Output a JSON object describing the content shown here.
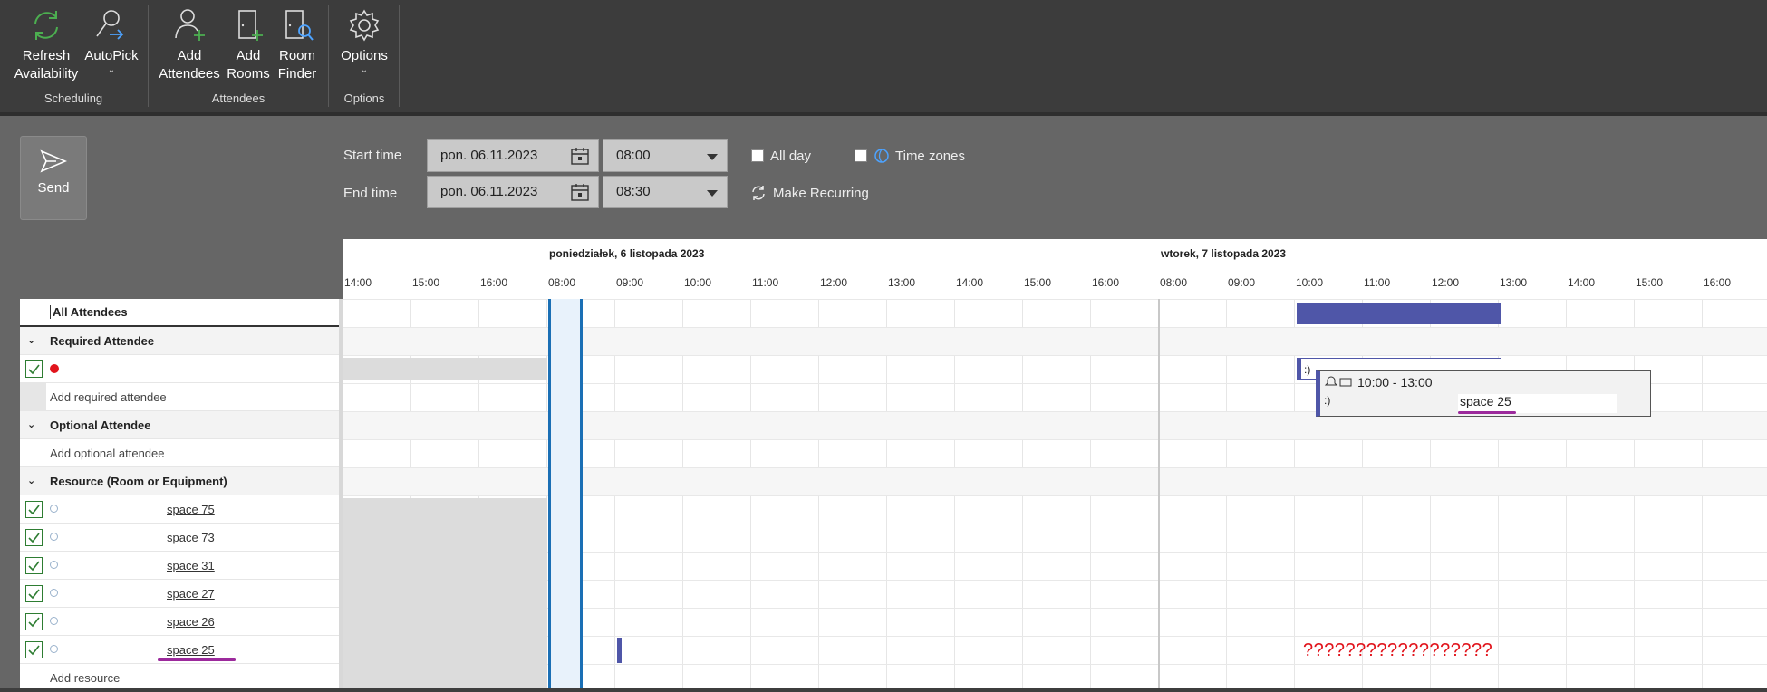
{
  "ribbon": {
    "buttons": [
      {
        "label1": "Refresh",
        "label2": "Availability"
      },
      {
        "label1": "AutoPick",
        "label2": "⌄"
      },
      {
        "label1": "Add",
        "label2": "Attendees"
      },
      {
        "label1": "Add",
        "label2": "Rooms"
      },
      {
        "label1": "Room",
        "label2": "Finder"
      },
      {
        "label1": "Options",
        "label2": "⌄"
      }
    ],
    "groups": [
      "Scheduling",
      "Attendees",
      "Options"
    ]
  },
  "send": {
    "label": "Send"
  },
  "time": {
    "start_label": "Start time",
    "end_label": "End time",
    "start_date": "pon. 06.11.2023",
    "start_time": "08:00",
    "end_date": "pon. 06.11.2023",
    "end_time": "08:30",
    "all_day": "All day",
    "time_zones": "Time zones",
    "make_recurring": "Make Recurring"
  },
  "timeline": {
    "day1": "poniedziałek, 6 listopada 2023",
    "day2": "wtorek, 7 listopada 2023",
    "hours": [
      "14:00",
      "15:00",
      "16:00",
      "08:00",
      "09:00",
      "10:00",
      "11:00",
      "12:00",
      "13:00",
      "14:00",
      "15:00",
      "16:00",
      "08:00",
      "09:00",
      "10:00",
      "11:00",
      "12:00",
      "13:00",
      "14:00",
      "15:00",
      "16:00"
    ]
  },
  "attendees": {
    "all": "All Attendees",
    "required_header": "Required Attendee",
    "add_required": "Add required attendee",
    "optional_header": "Optional Attendee",
    "add_optional": "Add optional attendee",
    "resource_header": "Resource (Room or Equipment)",
    "resources": [
      "space 75",
      "space 73",
      "space 31",
      "space 27",
      "space 26",
      "space 25"
    ],
    "add_resource": "Add resource"
  },
  "popup": {
    "time": "10:00 - 13:00",
    "subject": ":)",
    "location": "space 25"
  },
  "event_label": ":)",
  "question_marks": "??????????????????"
}
